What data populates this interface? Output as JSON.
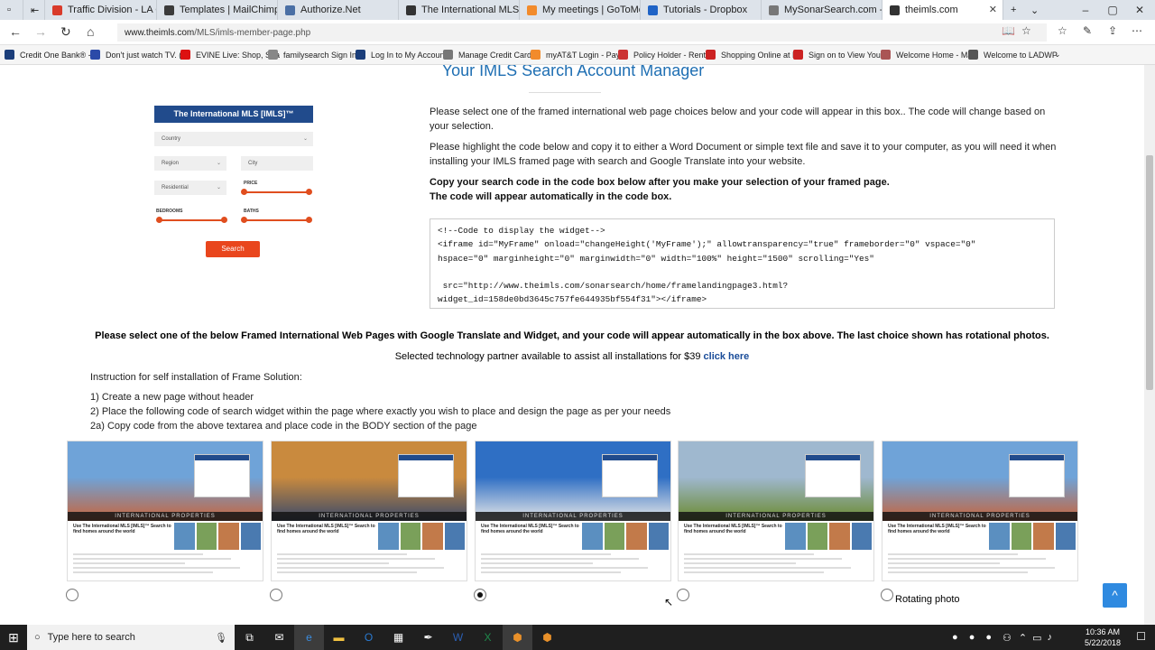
{
  "browser": {
    "tabs": [
      {
        "label": "Traffic Division - LA Court",
        "color": "#d93b2b",
        "active": false
      },
      {
        "label": "Templates | MailChimp",
        "color": "#3b3b3b",
        "active": false
      },
      {
        "label": "Authorize.Net",
        "color": "#4a6fa5",
        "active": false
      },
      {
        "label": "The International MLS [IMLS",
        "color": "#333333",
        "active": false
      },
      {
        "label": "My meetings | GoToMeeting",
        "color": "#f28b2c",
        "active": false
      },
      {
        "label": "Tutorials - Dropbox",
        "color": "#1f63c6",
        "active": false
      },
      {
        "label": "MySonarSearch.com - Prop",
        "color": "#777777",
        "active": false
      },
      {
        "label": "theimls.com",
        "color": "#333333",
        "active": true
      }
    ],
    "url_host": "www.theimls.com",
    "url_path": "/MLS/imls-member-page.php",
    "favorites": [
      "Credit One Bank® - (",
      "Don't just watch TV. (",
      "EVINE Live: Shop, Sha",
      "familysearch Sign In t",
      "Log In to My Account",
      "Manage Credit Card /",
      "myAT&T Login - Pay",
      "Policy Holder - Rente",
      "Shopping Online at H",
      "Sign on to View Your",
      "Welcome Home - Ma",
      "Welcome to LADWP"
    ]
  },
  "page": {
    "title": "Your IMLS Search Account Manager",
    "widget": {
      "header": "The International MLS [IMLS]™",
      "country": "Country",
      "region": "Region",
      "city": "City",
      "type": "Residential",
      "price": "PRICE",
      "bedrooms": "BEDROOMS",
      "baths": "BATHS",
      "search": "Search"
    },
    "para1": "Please select one of the framed international web page choices below and your code will appear in this box.. The code will change based on your selection.",
    "para2": "Please highlight the code below and copy it to either a Word Document or simple text file and save it to your computer, as you will need it when installing your IMLS framed page with search and Google Translate into your website.",
    "bold1": "Copy your search code in the code box below after you make your selection of your framed page.",
    "bold2": "The code will appear automatically in the code box.",
    "code": "<!--Code to display the widget-->\n<iframe id=\"MyFrame\" onload=\"changeHeight('MyFrame');\" allowtransparency=\"true\" frameborder=\"0\" vspace=\"0\"\nhspace=\"0\" marginheight=\"0\" marginwidth=\"0\" width=\"100%\" height=\"1500\" scrolling=\"Yes\"\n\n src=\"http://www.theimls.com/sonarsearch/home/framelandingpage3.html?\nwidget_id=158de0bd3645c757fe644935bf554f31\"></iframe>",
    "notice": "Please select one of the below Framed International Web Pages with Google Translate and Widget, and your code will appear automatically in the box above. The last choice shown has rotational photos.",
    "tech_text": "Selected technology partner available to assist all installations for $39",
    "tech_link": "click here",
    "instr_title": "Instruction for self installation of Frame Solution:",
    "instr1": "1) Create a new page without header",
    "instr2": "2) Place the following code of search widget within the page where exactly you wish to place and design the page as per your needs",
    "instr3": "2a) Copy code from the above textarea and place code in the BODY section of the page",
    "card_banner": "INTERNATIONAL PROPERTIES",
    "card_text": "Use The International MLS [IMLS]™ Search to find homes around the world",
    "cards": [
      {
        "sky": "#6fa3d8",
        "ground": "#c8643a",
        "selected": false
      },
      {
        "sky": "#c98a3e",
        "ground": "#3a4a6a",
        "selected": false
      },
      {
        "sky": "#2f6fc4",
        "ground": "#e8e8e8",
        "selected": true
      },
      {
        "sky": "#9fb8cf",
        "ground": "#6b8a2e",
        "selected": false
      },
      {
        "sky": "#6fa3d8",
        "ground": "#c8643a",
        "selected": false
      }
    ],
    "rotating_label": "Rotating photo",
    "scroll_top": "^"
  },
  "taskbar": {
    "search_placeholder": "Type here to search",
    "time": "10:36 AM",
    "date": "5/22/2018"
  }
}
